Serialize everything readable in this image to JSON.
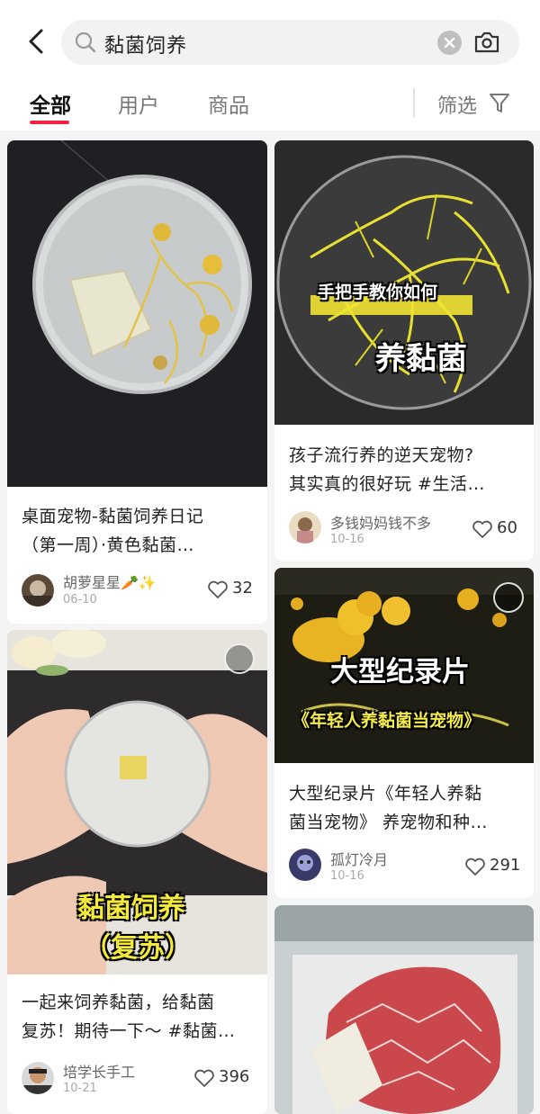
{
  "search": {
    "query": "黏菌饲养"
  },
  "tabs": [
    {
      "label": "全部",
      "active": true
    },
    {
      "label": "用户",
      "active": false
    },
    {
      "label": "商品",
      "active": false
    }
  ],
  "filter_label": "筛选",
  "accent": "#ff2442",
  "cards": [
    {
      "title": "桌面宠物-黏菌饲养日记\n（第一周）·黄色黏菌…",
      "author": "胡萝星星🥕✨",
      "date": "06-10",
      "likes": "32",
      "overlay": []
    },
    {
      "title": "孩子流行养的逆天宠物?\n其实真的很好玩 #生活…",
      "author": "多钱妈妈钱不多",
      "date": "10-16",
      "likes": "60",
      "overlay": [
        "手把手教你如何",
        "养黏菌"
      ]
    },
    {
      "title": "大型纪录片《年轻人养黏\n菌当宠物》 养宠物和种…",
      "author": "孤灯冷月",
      "date": "10-16",
      "likes": "291",
      "overlay": [
        "大型纪录片",
        "《年轻人养黏菌当宠物》"
      ]
    },
    {
      "title": "一起来饲养黏菌，给黏菌\n复苏！期待一下～ #黏菌…",
      "author": "培学长手工",
      "date": "10-21",
      "likes": "396",
      "overlay": [
        "黏菌饲养",
        "（复苏）"
      ]
    },
    {
      "title": "",
      "author": "",
      "date": "",
      "likes": "",
      "overlay": []
    }
  ]
}
